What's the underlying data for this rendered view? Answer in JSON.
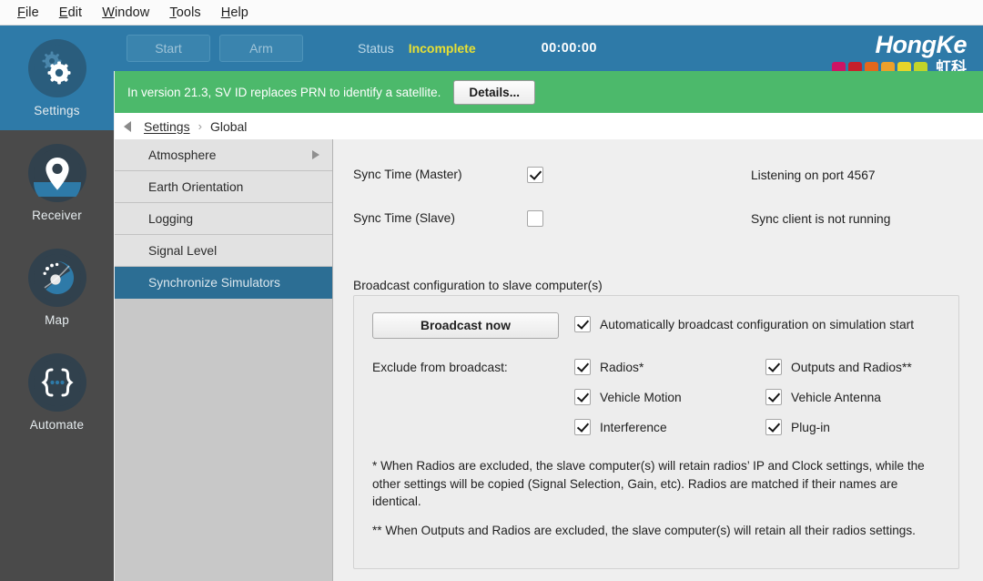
{
  "menubar": [
    {
      "mnemonic": "F",
      "rest": "ile"
    },
    {
      "mnemonic": "E",
      "rest": "dit"
    },
    {
      "mnemonic": "W",
      "rest": "indow"
    },
    {
      "mnemonic": "T",
      "rest": "ools"
    },
    {
      "mnemonic": "H",
      "rest": "elp"
    }
  ],
  "rail": {
    "items": [
      {
        "label": "Settings",
        "icon": "gears-icon",
        "active": true
      },
      {
        "label": "Receiver",
        "icon": "map-pin-icon",
        "active": false
      },
      {
        "label": "Map",
        "icon": "globe-aperture-icon",
        "active": false
      },
      {
        "label": "Automate",
        "icon": "curly-braces-icon",
        "active": false
      }
    ]
  },
  "topbar": {
    "start_label": "Start",
    "arm_label": "Arm",
    "status_label": "Status",
    "status_value": "Incomplete",
    "status_color": "#e8e033",
    "clock": "00:00:00",
    "background": "#2e7aa8"
  },
  "brand": {
    "word": "HongKe",
    "chinese": "虹科",
    "swatches": [
      "#cc1464",
      "#c5202a",
      "#e4671c",
      "#eda02b",
      "#e8d529",
      "#c2d42a"
    ]
  },
  "notification": {
    "text": "In version 21.3, SV ID replaces PRN to identify a satellite.",
    "button_label": "Details...",
    "background": "#4cb96b"
  },
  "breadcrumb": {
    "back_icon": "back-triangle-icon",
    "link": "Settings",
    "separator": "›",
    "current": "Global"
  },
  "subnav": {
    "items": [
      {
        "label": "Atmosphere",
        "has_submenu": true,
        "selected": false
      },
      {
        "label": "Earth Orientation",
        "has_submenu": false,
        "selected": false
      },
      {
        "label": "Logging",
        "has_submenu": false,
        "selected": false
      },
      {
        "label": "Signal Level",
        "has_submenu": false,
        "selected": false
      },
      {
        "label": "Synchronize Simulators",
        "has_submenu": false,
        "selected": true
      }
    ],
    "selected_color": "#2c6e94"
  },
  "main": {
    "sync_master_label": "Sync Time (Master)",
    "sync_master_checked": true,
    "sync_master_status": "Listening on port 4567",
    "sync_slave_label": "Sync Time (Slave)",
    "sync_slave_checked": false,
    "sync_slave_status": "Sync client is not running",
    "group_title": "Broadcast configuration to slave computer(s)",
    "broadcast_now_label": "Broadcast now",
    "auto_broadcast_label": "Automatically broadcast configuration on simulation start",
    "auto_broadcast_checked": true,
    "exclude_label": "Exclude from broadcast:",
    "exclude_left": [
      {
        "label": "Radios*",
        "checked": true
      },
      {
        "label": "Vehicle Motion",
        "checked": true
      },
      {
        "label": "Interference",
        "checked": true
      }
    ],
    "exclude_right": [
      {
        "label": "Outputs and Radios**",
        "checked": true
      },
      {
        "label": "Vehicle Antenna",
        "checked": true
      },
      {
        "label": "Plug-in",
        "checked": true
      }
    ],
    "note_one": "* When Radios are excluded, the slave computer(s) will retain radios’ IP and Clock settings, while the other settings will be copied (Signal Selection, Gain, etc). Radios are matched if their names are identical.",
    "note_two": "** When Outputs and Radios are excluded, the slave computer(s) will retain all their radios settings."
  }
}
